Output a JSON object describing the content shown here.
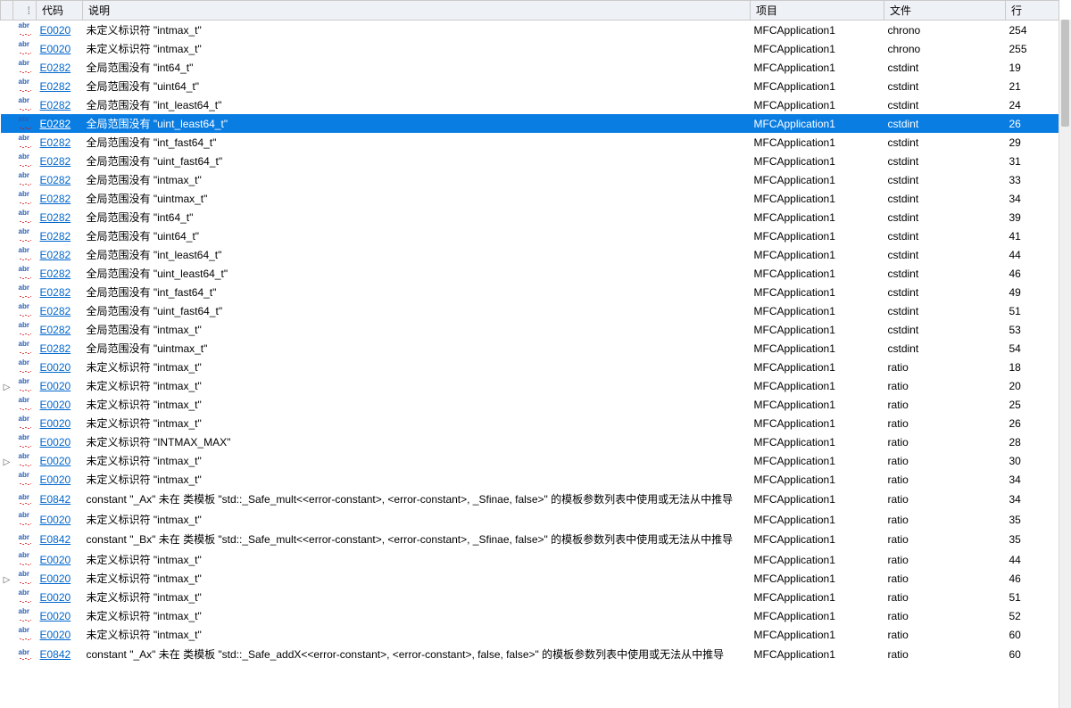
{
  "headers": {
    "expand": "",
    "code": "代码",
    "desc": "说明",
    "project": "项目",
    "file": "文件",
    "line": "行"
  },
  "rows": [
    {
      "exp": "",
      "code": "E0020",
      "desc": "未定义标识符 \"intmax_t\"",
      "project": "MFCApplication1",
      "file": "chrono",
      "line": "254"
    },
    {
      "exp": "",
      "code": "E0020",
      "desc": "未定义标识符 \"intmax_t\"",
      "project": "MFCApplication1",
      "file": "chrono",
      "line": "255"
    },
    {
      "exp": "",
      "code": "E0282",
      "desc": "全局范围没有 \"int64_t\"",
      "project": "MFCApplication1",
      "file": "cstdint",
      "line": "19"
    },
    {
      "exp": "",
      "code": "E0282",
      "desc": "全局范围没有 \"uint64_t\"",
      "project": "MFCApplication1",
      "file": "cstdint",
      "line": "21"
    },
    {
      "exp": "",
      "code": "E0282",
      "desc": "全局范围没有 \"int_least64_t\"",
      "project": "MFCApplication1",
      "file": "cstdint",
      "line": "24"
    },
    {
      "exp": "",
      "code": "E0282",
      "desc": "全局范围没有 \"uint_least64_t\"",
      "project": "MFCApplication1",
      "file": "cstdint",
      "line": "26",
      "selected": true
    },
    {
      "exp": "",
      "code": "E0282",
      "desc": "全局范围没有 \"int_fast64_t\"",
      "project": "MFCApplication1",
      "file": "cstdint",
      "line": "29"
    },
    {
      "exp": "",
      "code": "E0282",
      "desc": "全局范围没有 \"uint_fast64_t\"",
      "project": "MFCApplication1",
      "file": "cstdint",
      "line": "31"
    },
    {
      "exp": "",
      "code": "E0282",
      "desc": "全局范围没有 \"intmax_t\"",
      "project": "MFCApplication1",
      "file": "cstdint",
      "line": "33"
    },
    {
      "exp": "",
      "code": "E0282",
      "desc": "全局范围没有 \"uintmax_t\"",
      "project": "MFCApplication1",
      "file": "cstdint",
      "line": "34"
    },
    {
      "exp": "",
      "code": "E0282",
      "desc": "全局范围没有 \"int64_t\"",
      "project": "MFCApplication1",
      "file": "cstdint",
      "line": "39"
    },
    {
      "exp": "",
      "code": "E0282",
      "desc": "全局范围没有 \"uint64_t\"",
      "project": "MFCApplication1",
      "file": "cstdint",
      "line": "41"
    },
    {
      "exp": "",
      "code": "E0282",
      "desc": "全局范围没有 \"int_least64_t\"",
      "project": "MFCApplication1",
      "file": "cstdint",
      "line": "44"
    },
    {
      "exp": "",
      "code": "E0282",
      "desc": "全局范围没有 \"uint_least64_t\"",
      "project": "MFCApplication1",
      "file": "cstdint",
      "line": "46"
    },
    {
      "exp": "",
      "code": "E0282",
      "desc": "全局范围没有 \"int_fast64_t\"",
      "project": "MFCApplication1",
      "file": "cstdint",
      "line": "49"
    },
    {
      "exp": "",
      "code": "E0282",
      "desc": "全局范围没有 \"uint_fast64_t\"",
      "project": "MFCApplication1",
      "file": "cstdint",
      "line": "51"
    },
    {
      "exp": "",
      "code": "E0282",
      "desc": "全局范围没有 \"intmax_t\"",
      "project": "MFCApplication1",
      "file": "cstdint",
      "line": "53"
    },
    {
      "exp": "",
      "code": "E0282",
      "desc": "全局范围没有 \"uintmax_t\"",
      "project": "MFCApplication1",
      "file": "cstdint",
      "line": "54"
    },
    {
      "exp": "",
      "code": "E0020",
      "desc": "未定义标识符 \"intmax_t\"",
      "project": "MFCApplication1",
      "file": "ratio",
      "line": "18"
    },
    {
      "exp": "▷",
      "code": "E0020",
      "desc": "未定义标识符 \"intmax_t\"",
      "project": "MFCApplication1",
      "file": "ratio",
      "line": "20"
    },
    {
      "exp": "",
      "code": "E0020",
      "desc": "未定义标识符 \"intmax_t\"",
      "project": "MFCApplication1",
      "file": "ratio",
      "line": "25"
    },
    {
      "exp": "",
      "code": "E0020",
      "desc": "未定义标识符 \"intmax_t\"",
      "project": "MFCApplication1",
      "file": "ratio",
      "line": "26"
    },
    {
      "exp": "",
      "code": "E0020",
      "desc": "未定义标识符 \"INTMAX_MAX\"",
      "project": "MFCApplication1",
      "file": "ratio",
      "line": "28"
    },
    {
      "exp": "▷",
      "code": "E0020",
      "desc": "未定义标识符 \"intmax_t\"",
      "project": "MFCApplication1",
      "file": "ratio",
      "line": "30"
    },
    {
      "exp": "",
      "code": "E0020",
      "desc": "未定义标识符 \"intmax_t\"",
      "project": "MFCApplication1",
      "file": "ratio",
      "line": "34"
    },
    {
      "exp": "",
      "code": "E0842",
      "desc": "constant \"_Ax\" 未在 类模板 \"std::_Safe_mult<<error-constant>, <error-constant>, _Sfinae, false>\" 的模板参数列表中使用或无法从中推导",
      "project": "MFCApplication1",
      "file": "ratio",
      "line": "34",
      "wrap": true
    },
    {
      "exp": "",
      "code": "E0020",
      "desc": "未定义标识符 \"intmax_t\"",
      "project": "MFCApplication1",
      "file": "ratio",
      "line": "35"
    },
    {
      "exp": "",
      "code": "E0842",
      "desc": "constant \"_Bx\" 未在 类模板 \"std::_Safe_mult<<error-constant>, <error-constant>, _Sfinae, false>\" 的模板参数列表中使用或无法从中推导",
      "project": "MFCApplication1",
      "file": "ratio",
      "line": "35",
      "wrap": true
    },
    {
      "exp": "",
      "code": "E0020",
      "desc": "未定义标识符 \"intmax_t\"",
      "project": "MFCApplication1",
      "file": "ratio",
      "line": "44"
    },
    {
      "exp": "▷",
      "code": "E0020",
      "desc": "未定义标识符 \"intmax_t\"",
      "project": "MFCApplication1",
      "file": "ratio",
      "line": "46"
    },
    {
      "exp": "",
      "code": "E0020",
      "desc": "未定义标识符 \"intmax_t\"",
      "project": "MFCApplication1",
      "file": "ratio",
      "line": "51"
    },
    {
      "exp": "",
      "code": "E0020",
      "desc": "未定义标识符 \"intmax_t\"",
      "project": "MFCApplication1",
      "file": "ratio",
      "line": "52"
    },
    {
      "exp": "",
      "code": "E0020",
      "desc": "未定义标识符 \"intmax_t\"",
      "project": "MFCApplication1",
      "file": "ratio",
      "line": "60"
    },
    {
      "exp": "",
      "code": "E0842",
      "desc": "constant \"_Ax\" 未在 类模板 \"std::_Safe_addX<<error-constant>, <error-constant>, false, false>\" 的模板参数列表中使用或无法从中推导",
      "project": "MFCApplication1",
      "file": "ratio",
      "line": "60",
      "wrap": true
    }
  ]
}
